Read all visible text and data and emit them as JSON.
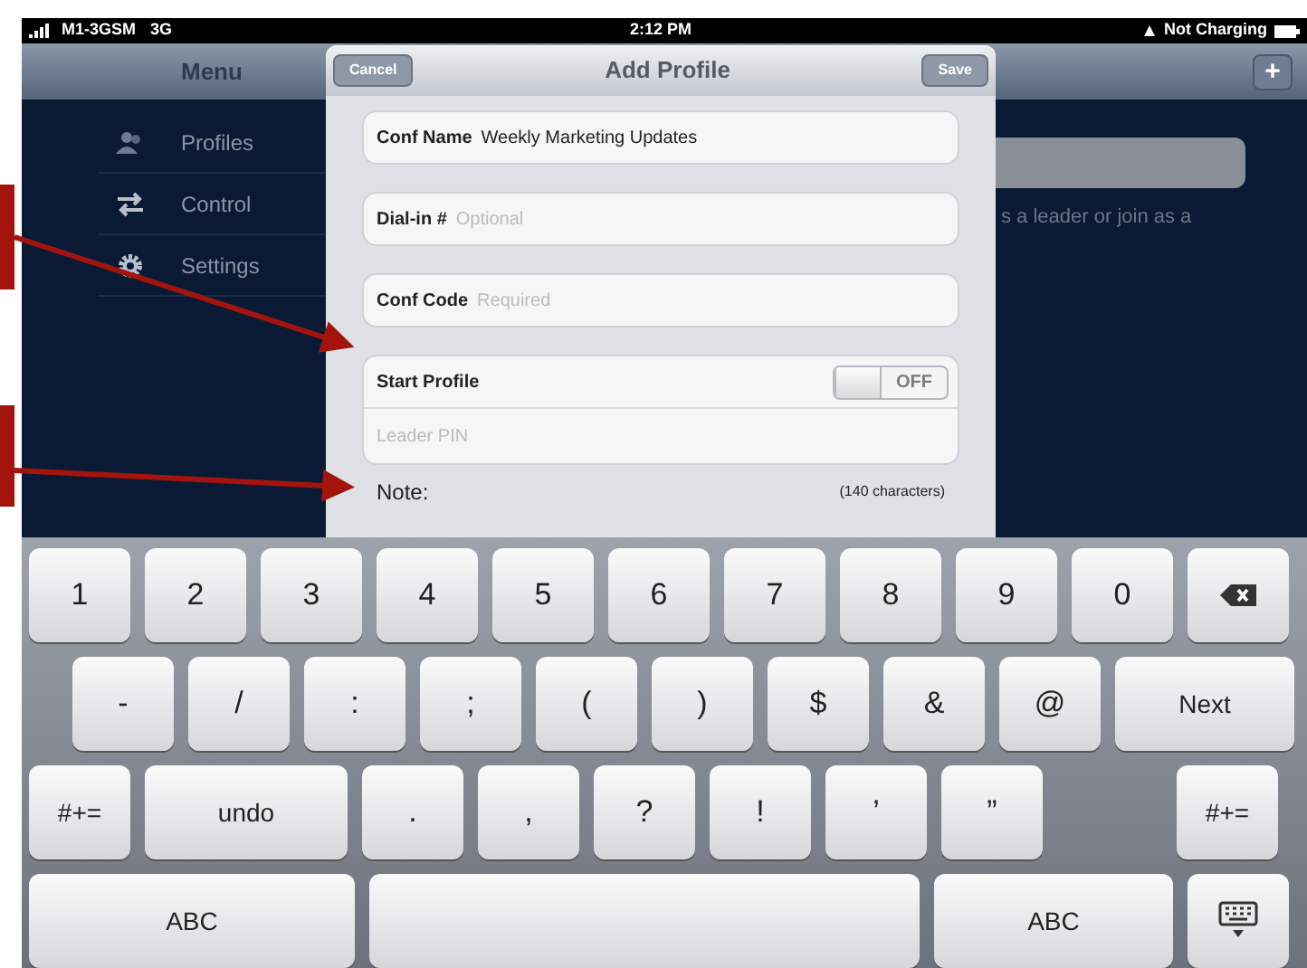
{
  "status_bar": {
    "carrier": "M1-3GSM",
    "network": "3G",
    "time": "2:12 PM",
    "battery_text": "Not Charging"
  },
  "nav": {
    "title": "Menu",
    "add_button": "+"
  },
  "sidebar": {
    "items": [
      {
        "label": "Profiles",
        "kind": "people"
      },
      {
        "label": "Control",
        "kind": "arrows"
      },
      {
        "label": "Settings",
        "kind": "gear"
      }
    ]
  },
  "background": {
    "text": "s a leader or join as a"
  },
  "dialog": {
    "title": "Add Profile",
    "cancel": "Cancel",
    "save": "Save",
    "fields": [
      {
        "label": "Conf Name",
        "value": "Weekly Marketing Updates"
      },
      {
        "label": "Dial-in #",
        "placeholder": "Optional"
      },
      {
        "label": "Conf Code",
        "placeholder": "Required"
      }
    ],
    "toggle_row": {
      "label": "Start Profile",
      "on": false,
      "text": "OFF"
    },
    "pin_placeholder": "Leader PIN",
    "note_label": "Note:",
    "note_hint": "(140 characters)"
  },
  "keyboard": {
    "rows": [
      [
        {
          "kind": "char",
          "label": "1"
        },
        {
          "kind": "char",
          "label": "2"
        },
        {
          "kind": "char",
          "label": "3"
        },
        {
          "kind": "char",
          "label": "4"
        },
        {
          "kind": "char",
          "label": "5"
        },
        {
          "kind": "char",
          "label": "6"
        },
        {
          "kind": "char",
          "label": "7"
        },
        {
          "kind": "char",
          "label": "8"
        },
        {
          "kind": "char",
          "label": "9"
        },
        {
          "kind": "char",
          "label": "0"
        },
        {
          "kind": "delete"
        }
      ],
      [
        {
          "kind": "char",
          "label": "-"
        },
        {
          "kind": "char",
          "label": "/"
        },
        {
          "kind": "char",
          "label": ":"
        },
        {
          "kind": "char",
          "label": ";"
        },
        {
          "kind": "char",
          "label": "("
        },
        {
          "kind": "char",
          "label": ")"
        },
        {
          "kind": "char",
          "label": "$"
        },
        {
          "kind": "char",
          "label": "&"
        },
        {
          "kind": "char",
          "label": "@"
        },
        {
          "kind": "next",
          "label": "Next"
        }
      ],
      [
        {
          "kind": "shift",
          "label": "#+="
        },
        {
          "kind": "undo",
          "label": "undo"
        },
        {
          "kind": "char",
          "label": "."
        },
        {
          "kind": "char",
          "label": ","
        },
        {
          "kind": "char",
          "label": "?"
        },
        {
          "kind": "char",
          "label": "!"
        },
        {
          "kind": "char",
          "label": "’"
        },
        {
          "kind": "char",
          "label": "”"
        },
        {
          "kind": "shift",
          "label": "#+="
        }
      ],
      [
        {
          "kind": "abc",
          "label": "ABC"
        },
        {
          "kind": "space"
        },
        {
          "kind": "abc2",
          "label": "ABC"
        },
        {
          "kind": "hide"
        }
      ]
    ]
  }
}
